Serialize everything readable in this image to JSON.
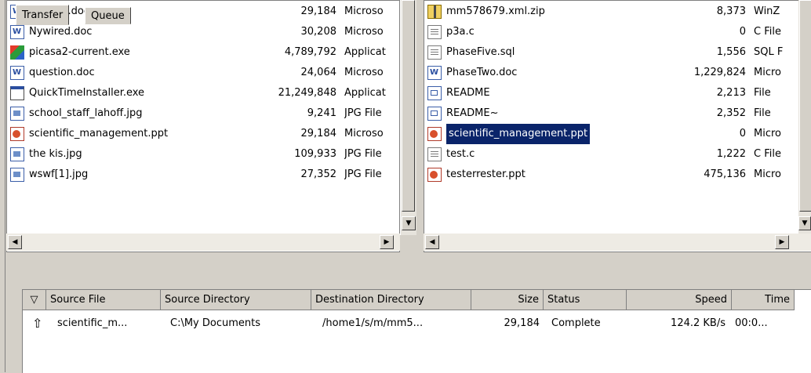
{
  "left_files": [
    {
      "name": "memo6.doc",
      "size": "29,184",
      "type": "Microso",
      "icon": "word-doc-icon",
      "cls": "ico-doc"
    },
    {
      "name": "Nywired.doc",
      "size": "30,208",
      "type": "Microso",
      "icon": "word-doc-icon",
      "cls": "ico-doc"
    },
    {
      "name": "picasa2-current.exe",
      "size": "4,789,792",
      "type": "Applicat",
      "icon": "picasa-icon",
      "cls": "ico-exe"
    },
    {
      "name": "question.doc",
      "size": "24,064",
      "type": "Microso",
      "icon": "word-doc-icon",
      "cls": "ico-doc"
    },
    {
      "name": "QuickTimeInstaller.exe",
      "size": "21,249,848",
      "type": "Applicat",
      "icon": "application-icon",
      "cls": "ico-app"
    },
    {
      "name": "school_staff_lahoff.jpg",
      "size": "9,241",
      "type": "JPG File",
      "icon": "image-file-icon",
      "cls": "ico-img"
    },
    {
      "name": "scientific_management.ppt",
      "size": "29,184",
      "type": "Microso",
      "icon": "powerpoint-icon",
      "cls": "ico-ppt"
    },
    {
      "name": "the kis.jpg",
      "size": "109,933",
      "type": "JPG File",
      "icon": "image-file-icon",
      "cls": "ico-img"
    },
    {
      "name": "wswf[1].jpg",
      "size": "27,352",
      "type": "JPG File",
      "icon": "image-file-icon",
      "cls": "ico-img"
    }
  ],
  "right_files": [
    {
      "name": "mm578679.xml.zip",
      "size": "8,373",
      "type": "WinZ",
      "icon": "zip-icon",
      "cls": "ico-zip"
    },
    {
      "name": "p3a.c",
      "size": "0",
      "type": "C File",
      "icon": "text-file-icon",
      "cls": "ico-txt"
    },
    {
      "name": "PhaseFive.sql",
      "size": "1,556",
      "type": "SQL F",
      "icon": "text-file-icon",
      "cls": "ico-txt"
    },
    {
      "name": "PhaseTwo.doc",
      "size": "1,229,824",
      "type": "Micro",
      "icon": "word-doc-icon",
      "cls": "ico-doc"
    },
    {
      "name": "README",
      "size": "2,213",
      "type": "File",
      "icon": "generic-file-icon",
      "cls": "ico-file"
    },
    {
      "name": "README~",
      "size": "2,352",
      "type": "File",
      "icon": "generic-file-icon",
      "cls": "ico-file"
    },
    {
      "name": "scientific_management.ppt",
      "size": "0",
      "type": "Micro",
      "icon": "powerpoint-icon",
      "cls": "ico-ppt",
      "selected": true
    },
    {
      "name": "test.c",
      "size": "1,222",
      "type": "C File",
      "icon": "text-file-icon",
      "cls": "ico-txt"
    },
    {
      "name": "testerrester.ppt",
      "size": "475,136",
      "type": "Micro",
      "icon": "powerpoint-icon",
      "cls": "ico-ppt"
    }
  ],
  "tabs": {
    "transfer": "Transfer",
    "queue": "Queue"
  },
  "transfer_headers": {
    "sort": "▽",
    "source_file": "Source File",
    "source_dir": "Source Directory",
    "dest_dir": "Destination Directory",
    "size": "Size",
    "status": "Status",
    "speed": "Speed",
    "time": "Time"
  },
  "transfer_row": {
    "direction_icon": "⇧",
    "source_file": "scientific_m...",
    "source_dir": "C:\\My Documents",
    "dest_dir": "/home1/s/m/mm5...",
    "size": "29,184",
    "status": "Complete",
    "speed": "124.2 KB/s",
    "time": "00:0..."
  }
}
